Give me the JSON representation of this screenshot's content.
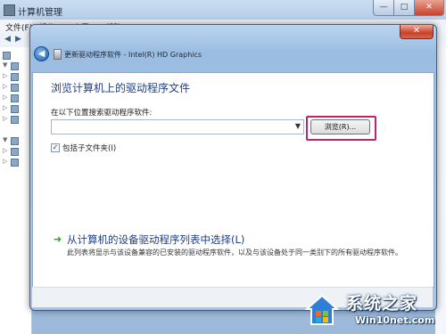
{
  "bg_window": {
    "title": "计算机管理",
    "menu": [
      "文件(F)",
      "操作(A)",
      "查看(V)",
      "帮助(H)"
    ],
    "controls": {
      "minimize": "—",
      "maximize": "□",
      "close": "✕"
    }
  },
  "dialog": {
    "title": "更新驱动程序软件 - Intel(R) HD Graphics",
    "close": "✕",
    "back": "◀",
    "heading": "浏览计算机上的驱动程序文件",
    "search_label": "在以下位置搜索驱动程序软件:",
    "path_value": "",
    "browse_button": "浏览(R)...",
    "subfolders_checked": true,
    "subfolders_label": "包括子文件夹(I)",
    "pick_link": "从计算机的设备驱动程序列表中选择(L)",
    "pick_description": "此列表将显示与该设备兼容的已安装的驱动程序软件，以及与该设备处于同一类别下的所有驱动程序软件。"
  },
  "watermark": {
    "name": "系统之家",
    "url": "Win10net.com"
  },
  "colors": {
    "heading": "#1e3f8a",
    "highlight": "#c0246a",
    "link_arrow": "#28a13b"
  }
}
